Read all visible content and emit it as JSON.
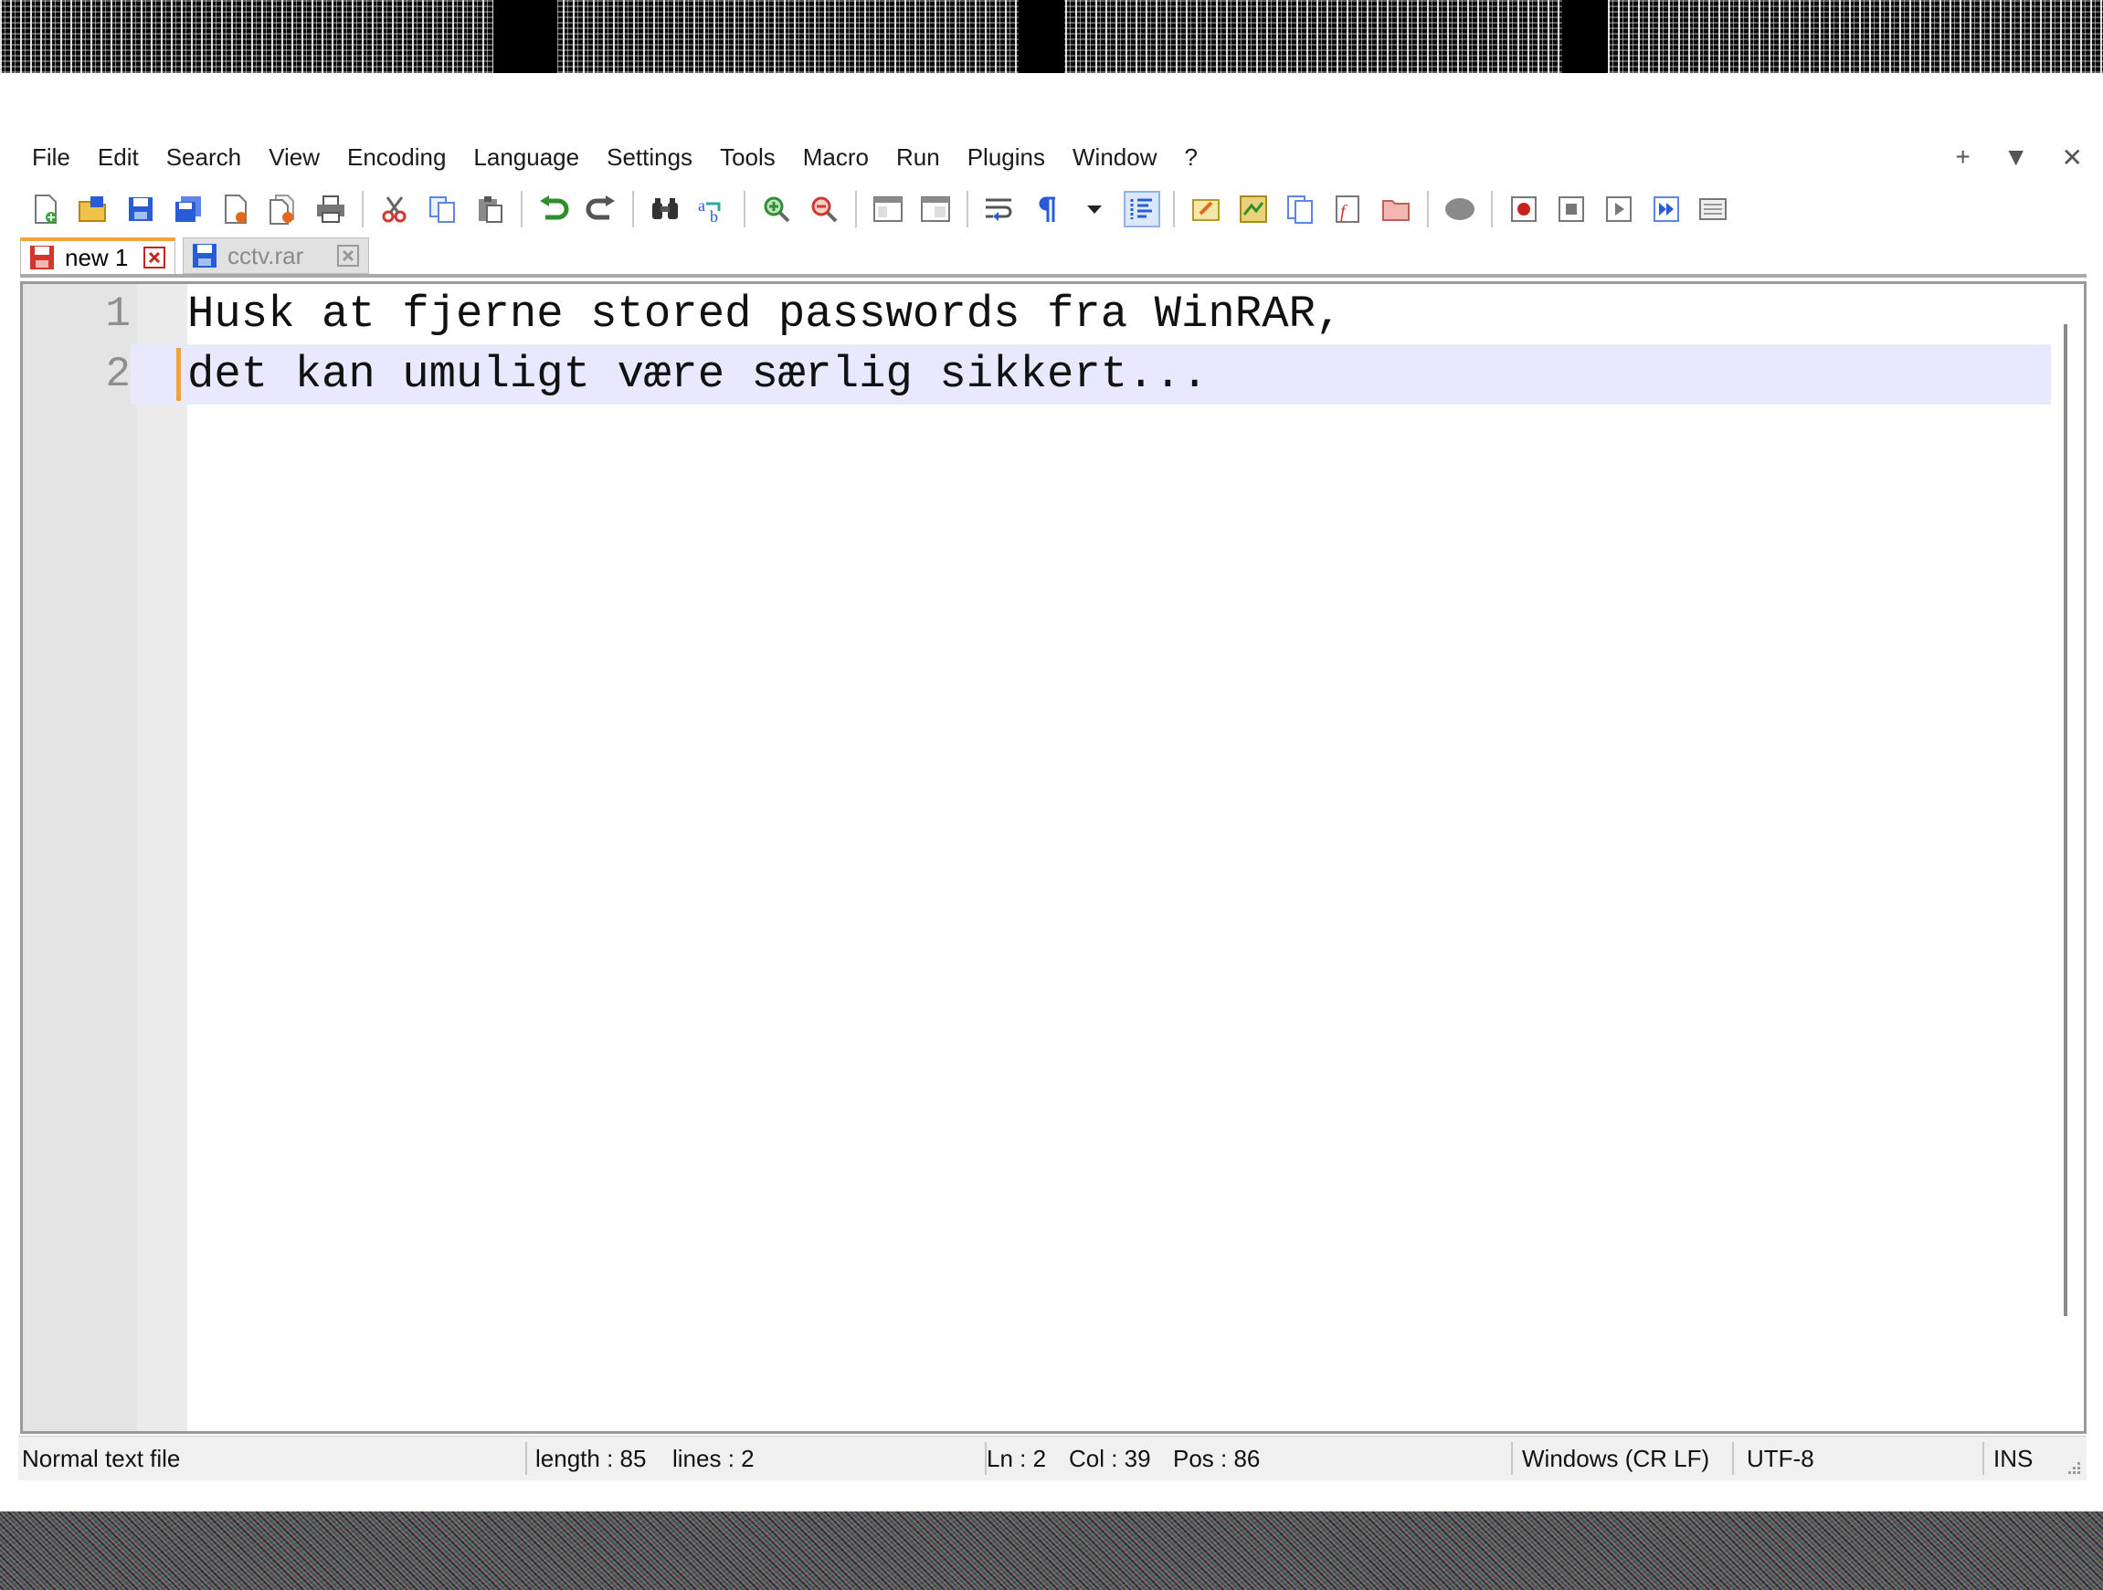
{
  "menu": [
    "File",
    "Edit",
    "Search",
    "View",
    "Encoding",
    "Language",
    "Settings",
    "Tools",
    "Macro",
    "Run",
    "Plugins",
    "Window",
    "?"
  ],
  "window_controls": {
    "add": "+",
    "dropdown": "▼",
    "close": "✕"
  },
  "tabs": [
    {
      "label": "new 1",
      "active": true
    },
    {
      "label": "cctv.rar",
      "active": false
    }
  ],
  "editor": {
    "lines": [
      {
        "num": "1",
        "text": "Husk at fjerne stored passwords fra WinRAR,"
      },
      {
        "num": "2",
        "text": "det kan umuligt være særlig sikkert..."
      }
    ],
    "current_line": 2
  },
  "status": {
    "filetype": "Normal text file",
    "length": "length : 85",
    "lines": "lines : 2",
    "ln": "Ln : 2",
    "col": "Col : 39",
    "pos": "Pos : 86",
    "eol": "Windows (CR LF)",
    "encoding": "UTF-8",
    "mode": "INS"
  },
  "colors": {
    "accent_orange": "#f2a33a",
    "current_line": "#e8e8ff",
    "toolbar_blue": "#2a5bd7"
  }
}
